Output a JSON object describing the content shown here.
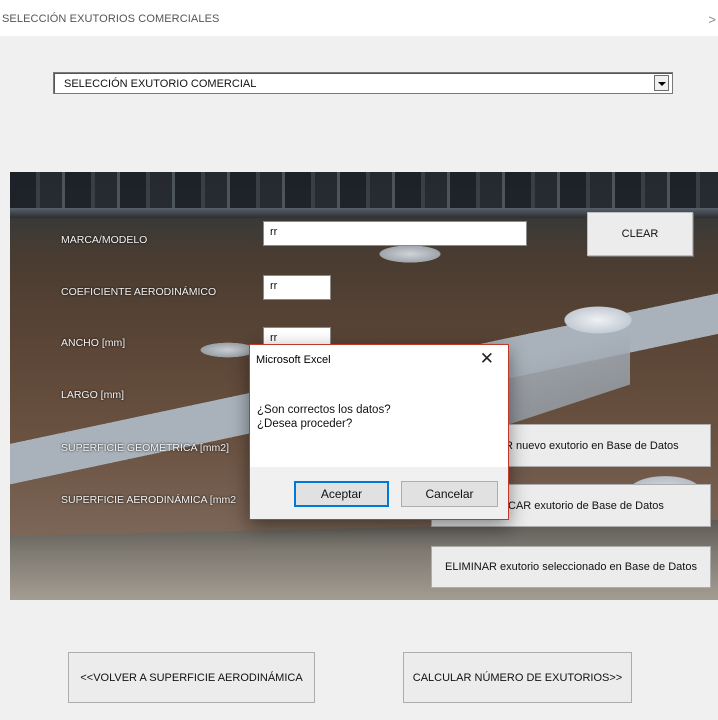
{
  "window": {
    "title": "SELECCIÓN EXUTORIOS COMERCIALES",
    "close_glyph": "×"
  },
  "selector": {
    "value": "SELECCIÓN EXUTORIO COMERCIAL"
  },
  "form": {
    "marca_label": "MARCA/MODELO",
    "marca_value": "rr",
    "coef_label": "COEFICIENTE AERODINÁMICO",
    "coef_value": "rr",
    "ancho_label": "ANCHO [mm]",
    "ancho_value": "rr",
    "largo_label": "LARGO [mm]",
    "sup_geo_label": "SUPERFICIE GEOMÉTRICA [mm2]",
    "sup_aero_label": "SUPERFICIE AERODINÁMICA [mm2"
  },
  "buttons": {
    "clear": "CLEAR",
    "add_db": "R nuevo exutorio en Base de Datos",
    "modify_db": "CAR exutorio de Base de Datos",
    "delete_db": "ELIMINAR exutorio seleccionado en Base de Datos",
    "back": "<<VOLVER A SUPERFICIE AERODINÁMICA",
    "calculate": "CALCULAR NÚMERO DE EXUTORIOS>>"
  },
  "dialog": {
    "title": "Microsoft Excel",
    "close": "✕",
    "line1": "¿Son correctos los datos?",
    "line2": "¿Desea proceder?",
    "ok": "Aceptar",
    "cancel": "Cancelar"
  },
  "icons": {
    "dropdown": "chevron-down-icon",
    "close": "close-icon"
  },
  "colors": {
    "dialog_border": "#c0392b",
    "primary_button_border": "#0078d7"
  }
}
